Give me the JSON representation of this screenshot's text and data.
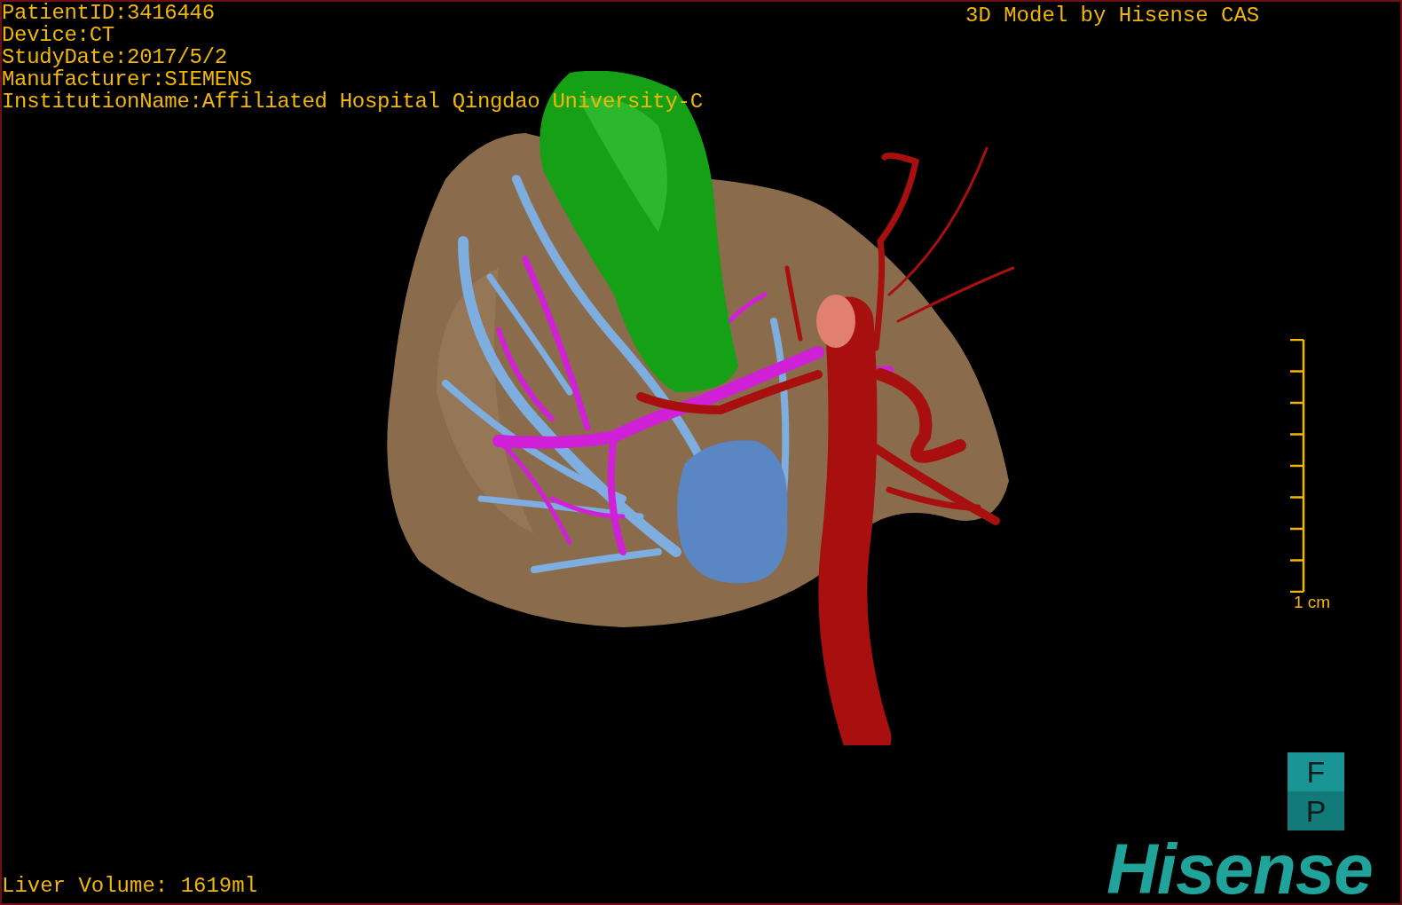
{
  "study_info": [
    "PatientID:3416446",
    "Device:CT",
    "StudyDate:2017/5/2",
    "Manufacturer:SIEMENS",
    "InstitutionName:Affiliated Hospital Qingdao University-C"
  ],
  "caption": "3D Model by Hisense CAS",
  "scale": {
    "label": "1 cm"
  },
  "orientation_marker": [
    "F",
    "P"
  ],
  "brand": "Hisense",
  "liver_volume": "Liver Volume: 1619ml"
}
